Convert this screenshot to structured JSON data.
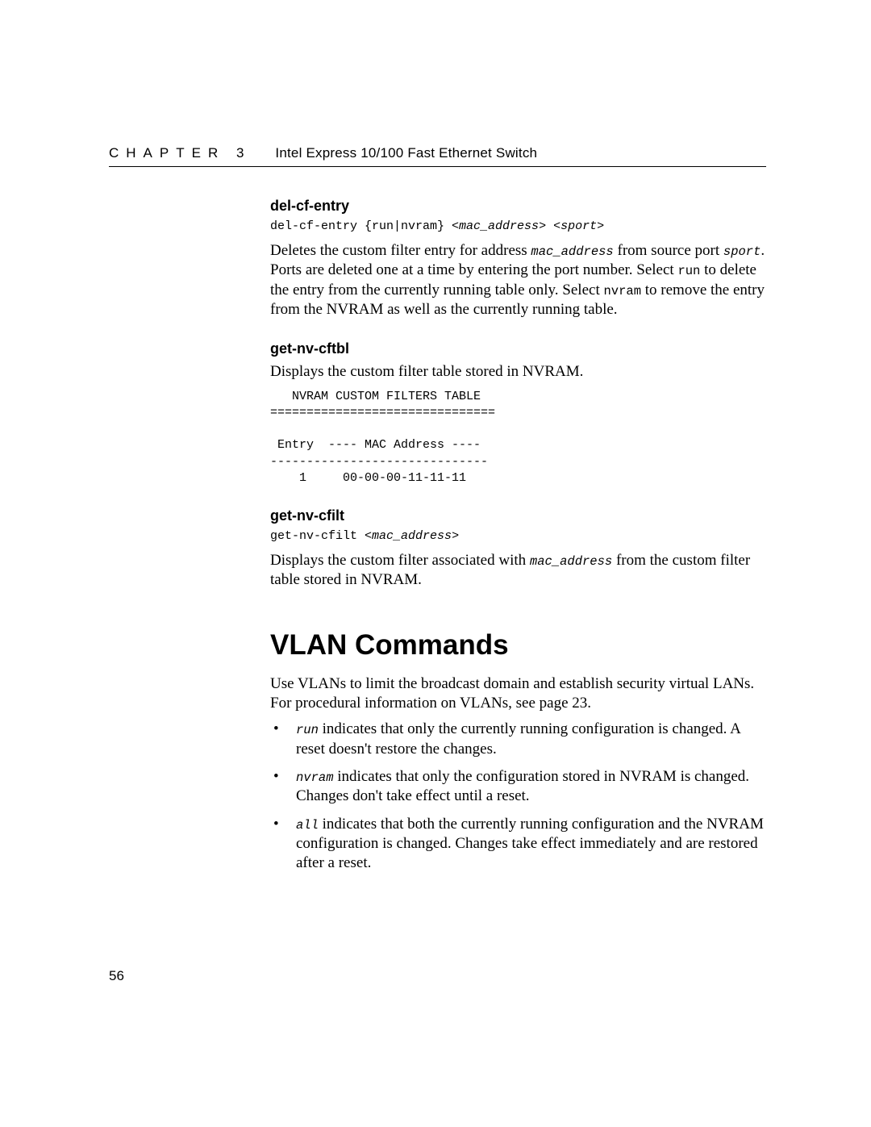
{
  "header": {
    "chapter": "CHAPTER 3",
    "title": "Intel Express 10/100 Fast Ethernet Switch"
  },
  "sections": {
    "delCfEntry": {
      "heading": "del-cf-entry",
      "syntax_pre": "del-cf-entry {run|nvram} <",
      "syntax_arg1": "mac_address",
      "syntax_mid": "> <",
      "syntax_arg2": "sport",
      "syntax_post": ">",
      "p1_a": "Deletes the custom filter entry for address ",
      "p1_mac": "mac_address",
      "p1_b": " from source port ",
      "p1_sport": "sport",
      "p1_c": ". Ports are deleted one at a time by entering the port number. Select ",
      "p1_run": "run",
      "p1_d": " to delete the entry from the currently running table only. Select ",
      "p1_nvram": "nvram",
      "p1_e": " to remove the entry from the NVRAM as well as the currently running table."
    },
    "getNvCftbl": {
      "heading": "get-nv-cftbl",
      "p1": "Displays the custom filter table stored in NVRAM.",
      "pre": "   NVRAM CUSTOM FILTERS TABLE\n===============================\n\n Entry  ---- MAC Address ----\n------------------------------\n    1     00-00-00-11-11-11"
    },
    "getNvCfilt": {
      "heading": "get-nv-cfilt",
      "syntax_pre": "get-nv-cfilt <",
      "syntax_arg": "mac_address",
      "syntax_post": ">",
      "p1_a": "Displays the custom filter associated with ",
      "p1_mac": "mac_address",
      "p1_b": " from the custom filter table stored in NVRAM."
    },
    "vlan": {
      "heading": "VLAN Commands",
      "intro": "Use VLANs to limit the broadcast domain and establish security virtual LANs. For procedural information on VLANs, see page 23.",
      "bullets": [
        {
          "kw": "run",
          "text": " indicates that only the currently running configuration is changed. A reset doesn't restore the changes."
        },
        {
          "kw": "nvram",
          "text": " indicates that only the configuration stored in NVRAM is changed. Changes don't take effect until a reset."
        },
        {
          "kw": "all",
          "text": " indicates that both the currently running configuration and the NVRAM configuration is changed. Changes take effect immediately and are restored after a reset."
        }
      ]
    }
  },
  "pageNumber": "56"
}
